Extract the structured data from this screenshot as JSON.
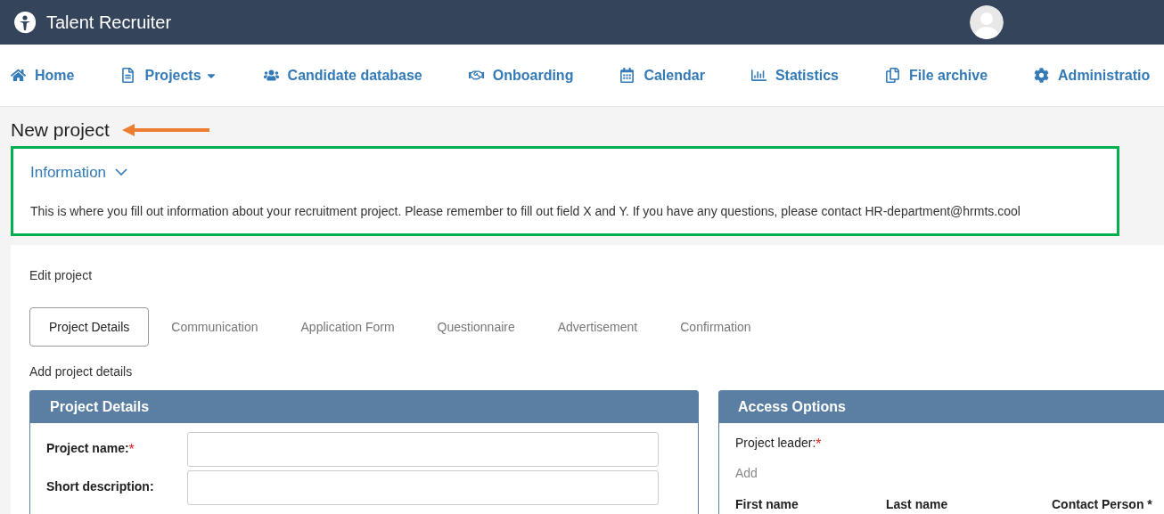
{
  "app": {
    "title": "Talent Recruiter"
  },
  "nav": [
    {
      "label": "Home",
      "dropdown": false
    },
    {
      "label": "Projects",
      "dropdown": true
    },
    {
      "label": "Candidate database",
      "dropdown": false
    },
    {
      "label": "Onboarding",
      "dropdown": false
    },
    {
      "label": "Calendar",
      "dropdown": false
    },
    {
      "label": "Statistics",
      "dropdown": false
    },
    {
      "label": "File archive",
      "dropdown": false
    },
    {
      "label": "Administratio",
      "dropdown": false
    }
  ],
  "page_title": "New project",
  "info": {
    "title": "Information",
    "expanded": true,
    "text": "This is where you fill out information about your recruitment project. Please remember to fill out field X and Y. If you have any questions, please contact HR-department@hrmts.cool"
  },
  "card": {
    "heading": "Edit project",
    "tabs": [
      {
        "label": "Project Details",
        "selected": true
      },
      {
        "label": "Communication",
        "selected": false
      },
      {
        "label": "Application Form",
        "selected": false
      },
      {
        "label": "Questionnaire",
        "selected": false
      },
      {
        "label": "Advertisement",
        "selected": false
      },
      {
        "label": "Confirmation",
        "selected": false
      }
    ],
    "subheading": "Add project details",
    "project_details": {
      "title": "Project Details",
      "fields": [
        {
          "label": "Project name:",
          "marker": "*"
        },
        {
          "label": "Short description:"
        }
      ]
    },
    "access_options": {
      "title": "Access Options",
      "leader_label": "Project leader:",
      "leader_marker": "*",
      "add_link": "Add",
      "columns": [
        "First name",
        "Last name",
        "Contact Person *"
      ]
    }
  }
}
